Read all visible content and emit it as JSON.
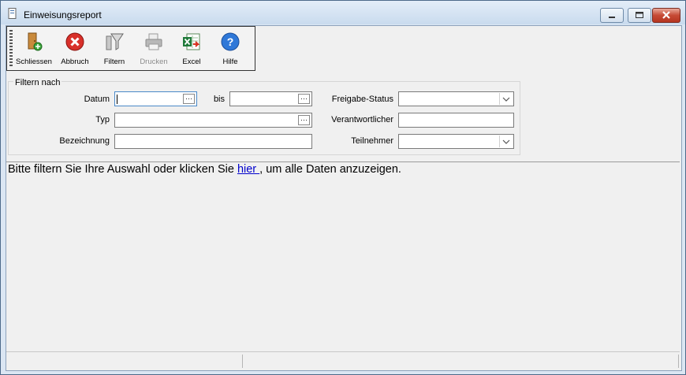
{
  "window": {
    "title": "Einweisungsreport"
  },
  "toolbar": {
    "items": [
      {
        "label": "Schliessen",
        "icon": "door-exit-icon",
        "enabled": true
      },
      {
        "label": "Abbruch",
        "icon": "cancel-icon",
        "enabled": true
      },
      {
        "label": "Filtern",
        "icon": "filter-icon",
        "enabled": true
      },
      {
        "label": "Drucken",
        "icon": "printer-icon",
        "enabled": false
      },
      {
        "label": "Excel",
        "icon": "excel-icon",
        "enabled": true
      },
      {
        "label": "Hilfe",
        "icon": "help-icon",
        "enabled": true
      }
    ]
  },
  "filter": {
    "legend": "Filtern nach",
    "datum_label": "Datum",
    "datum_value": "",
    "bis_label": "bis",
    "bis_value": "",
    "typ_label": "Typ",
    "typ_value": "",
    "bezeichnung_label": "Bezeichnung",
    "bezeichnung_value": "",
    "freigabe_label": "Freigabe-Status",
    "freigabe_value": "",
    "verantwortlicher_label": "Verantwortlicher",
    "verantwortlicher_value": "",
    "teilnehmer_label": "Teilnehmer",
    "teilnehmer_value": "",
    "ellipsis": "···"
  },
  "message": {
    "before": "Bitte filtern Sie Ihre Auswahl oder klicken Sie ",
    "link": " hier ",
    "after": ", um alle Daten anzuzeigen."
  }
}
